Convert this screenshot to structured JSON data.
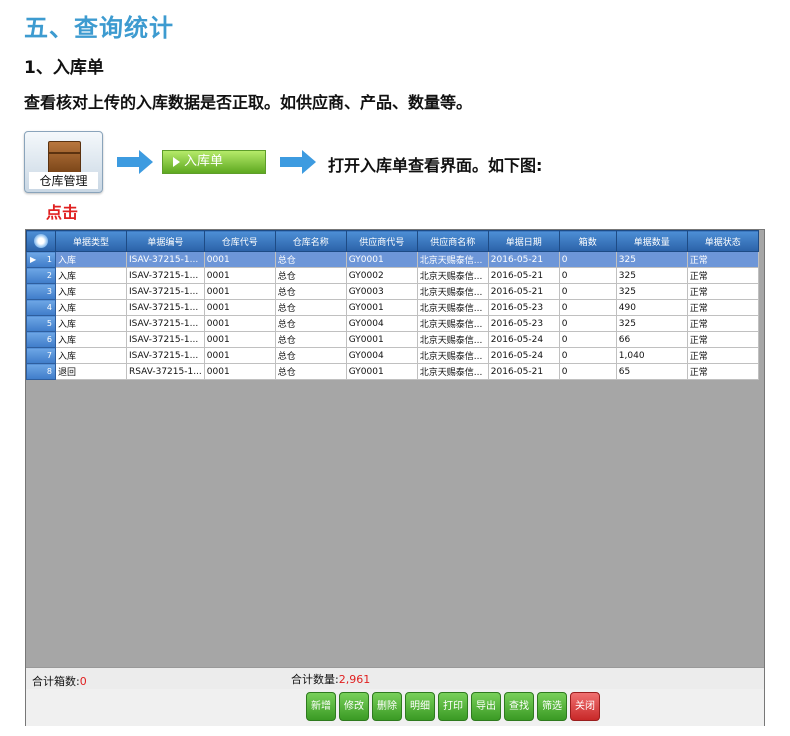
{
  "doc": {
    "section_title": "五、查询统计",
    "sub_title": "1、入库单",
    "desc": "查看核对上传的入库数据是否正取。如供应商、产品、数量等。",
    "wm_label": "仓库管理",
    "menu_label": "入库单",
    "open_text": "打开入库单查看界面。如下图:",
    "click_text": "点击"
  },
  "grid": {
    "columns": [
      "单据类型",
      "单据编号",
      "仓库代号",
      "仓库名称",
      "供应商代号",
      "供应商名称",
      "单据日期",
      "箱数",
      "单据数量",
      "单据状态"
    ],
    "rows": [
      [
        "1",
        "入库",
        "ISAV-37215-1...",
        "0001",
        "总仓",
        "GY0001",
        "北京天赐泰信...",
        "2016-05-21",
        "0",
        "325",
        "正常"
      ],
      [
        "2",
        "入库",
        "ISAV-37215-1...",
        "0001",
        "总仓",
        "GY0002",
        "北京天赐泰信...",
        "2016-05-21",
        "0",
        "325",
        "正常"
      ],
      [
        "3",
        "入库",
        "ISAV-37215-1...",
        "0001",
        "总仓",
        "GY0003",
        "北京天赐泰信...",
        "2016-05-21",
        "0",
        "325",
        "正常"
      ],
      [
        "4",
        "入库",
        "ISAV-37215-1...",
        "0001",
        "总仓",
        "GY0001",
        "北京天赐泰信...",
        "2016-05-23",
        "0",
        "490",
        "正常"
      ],
      [
        "5",
        "入库",
        "ISAV-37215-1...",
        "0001",
        "总仓",
        "GY0004",
        "北京天赐泰信...",
        "2016-05-23",
        "0",
        "325",
        "正常"
      ],
      [
        "6",
        "入库",
        "ISAV-37215-1...",
        "0001",
        "总仓",
        "GY0001",
        "北京天赐泰信...",
        "2016-05-24",
        "0",
        "66",
        "正常"
      ],
      [
        "7",
        "入库",
        "ISAV-37215-1...",
        "0001",
        "总仓",
        "GY0004",
        "北京天赐泰信...",
        "2016-05-24",
        "0",
        "1,040",
        "正常"
      ],
      [
        "8",
        "退回",
        "RSAV-37215-1...",
        "0001",
        "总仓",
        "GY0001",
        "北京天赐泰信...",
        "2016-05-21",
        "0",
        "65",
        "正常"
      ]
    ]
  },
  "status": {
    "boxes_label": "合计箱数:",
    "boxes_value": "0",
    "qty_label": "合计数量:",
    "qty_value": "2,961"
  },
  "buttons": [
    "新增",
    "修改",
    "删除",
    "明细",
    "打印",
    "导出",
    "查找",
    "筛选",
    "关闭"
  ],
  "colors": {
    "title_blue": "#3d9bd0",
    "accent_red": "#e02020",
    "btn_green": "#3a9a24",
    "btn_red": "#c82828"
  }
}
